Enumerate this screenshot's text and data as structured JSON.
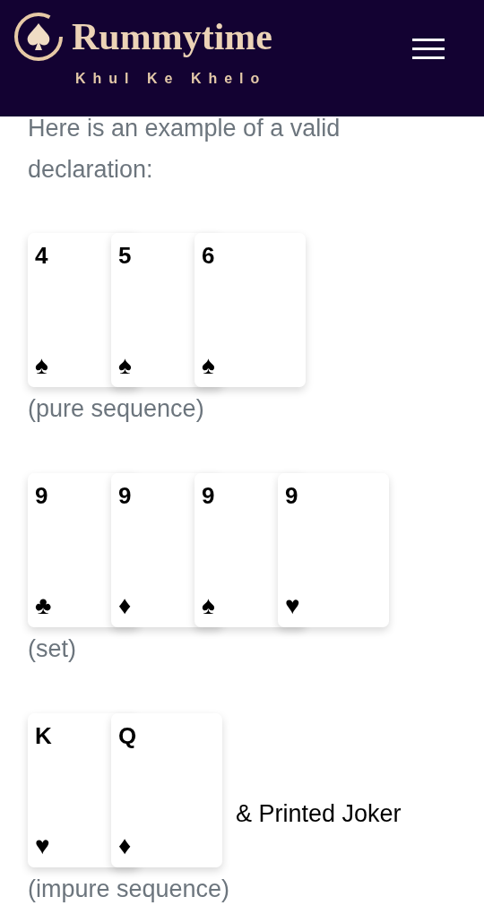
{
  "header": {
    "brand": "Rummytime",
    "tagline": "Khul Ke Khelo"
  },
  "intro": "Here is an example of a valid declaration:",
  "groups": [
    {
      "cards": [
        {
          "rank": "4",
          "suit": "♠"
        },
        {
          "rank": "5",
          "suit": "♠"
        },
        {
          "rank": "6",
          "suit": "♠"
        }
      ],
      "label": "(pure sequence)"
    },
    {
      "cards": [
        {
          "rank": "9",
          "suit": "♣"
        },
        {
          "rank": "9",
          "suit": "♦"
        },
        {
          "rank": "9",
          "suit": "♠"
        },
        {
          "rank": "9",
          "suit": "♥"
        }
      ],
      "label": "(set)"
    },
    {
      "cards": [
        {
          "rank": "K",
          "suit": "♥"
        },
        {
          "rank": "Q",
          "suit": "♦"
        }
      ],
      "extra": "& Printed Joker",
      "label": "(impure sequence)"
    }
  ]
}
